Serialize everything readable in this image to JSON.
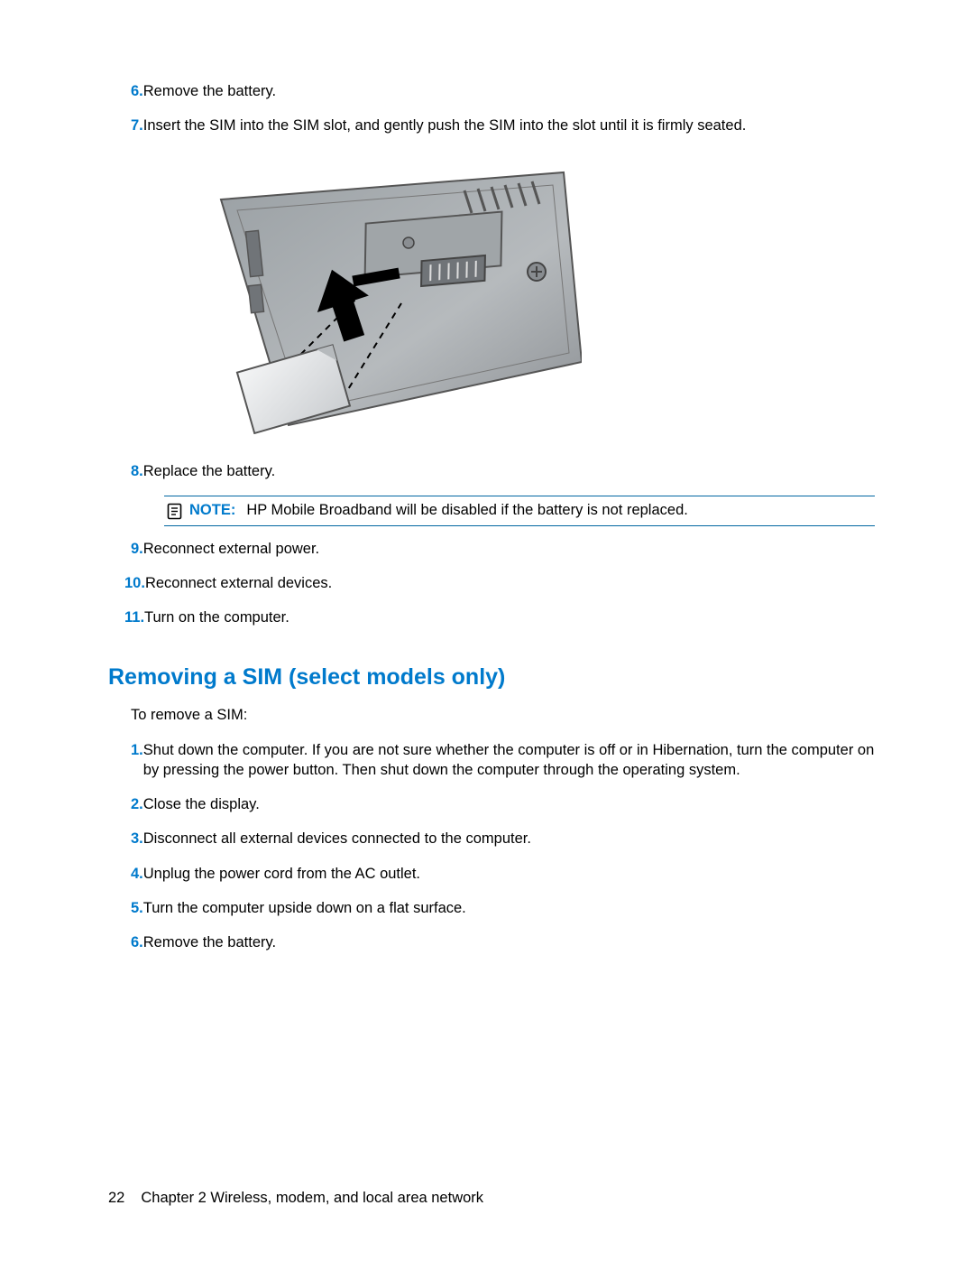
{
  "top_list": [
    {
      "num": "6.",
      "text": "Remove the battery."
    },
    {
      "num": "7.",
      "text": "Insert the SIM into the SIM slot, and gently push the SIM into the slot until it is firmly seated."
    }
  ],
  "after_image_list_first": {
    "num": "8.",
    "text": "Replace the battery."
  },
  "note": {
    "label": "NOTE:",
    "text": "HP Mobile Broadband will be disabled if the battery is not replaced."
  },
  "after_note_list": [
    {
      "num": "9.",
      "text": "Reconnect external power."
    },
    {
      "num": "10.",
      "text": "Reconnect external devices."
    },
    {
      "num": "11.",
      "text": "Turn on the computer."
    }
  ],
  "section_heading": "Removing a SIM (select models only)",
  "section_intro": "To remove a SIM:",
  "section_list": [
    {
      "num": "1.",
      "text": "Shut down the computer. If you are not sure whether the computer is off or in Hibernation, turn the computer on by pressing the power button. Then shut down the computer through the operating system."
    },
    {
      "num": "2.",
      "text": "Close the display."
    },
    {
      "num": "3.",
      "text": "Disconnect all external devices connected to the computer."
    },
    {
      "num": "4.",
      "text": "Unplug the power cord from the AC outlet."
    },
    {
      "num": "5.",
      "text": "Turn the computer upside down on a flat surface."
    },
    {
      "num": "6.",
      "text": "Remove the battery."
    }
  ],
  "footer": {
    "page_number": "22",
    "chapter": "Chapter 2   Wireless, modem, and local area network"
  }
}
